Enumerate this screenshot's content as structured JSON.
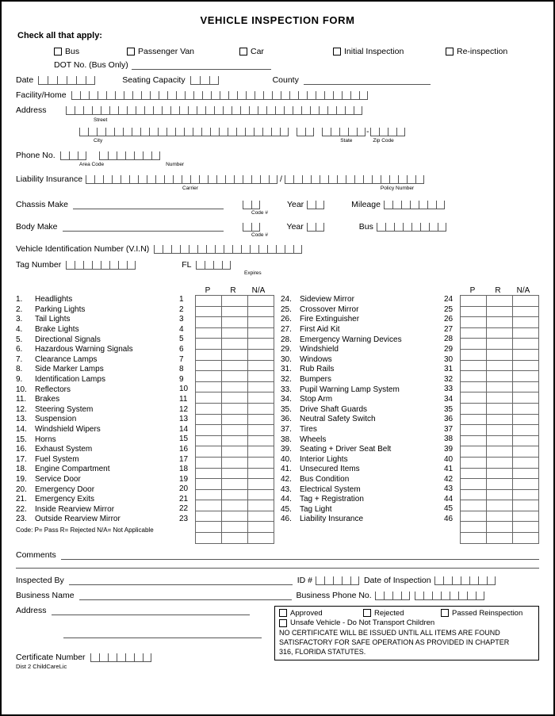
{
  "title": "VEHICLE INSPECTION FORM",
  "check_all_label": "Check all that apply:",
  "vehicle_types": [
    {
      "label": "Bus"
    },
    {
      "label": "Passenger Van"
    },
    {
      "label": "Car"
    },
    {
      "label": "Initial Inspection"
    },
    {
      "label": "Re-inspection"
    }
  ],
  "dot": {
    "label": "DOT No. (Bus Only)"
  },
  "date": {
    "label": "Date",
    "cells": 6
  },
  "seating": {
    "label": "Seating Capacity",
    "cells": 3
  },
  "county": {
    "label": "County"
  },
  "facility": {
    "label": "Facility/Home",
    "cells": 34
  },
  "address": {
    "label": "Address",
    "street_cells": 34,
    "street_caption": "Street",
    "city_cells": 24,
    "city_caption": "City",
    "state_cells": 2,
    "state_caption": "State",
    "zip_cells": 5,
    "zip_caption": "Zip Code",
    "zip4_cells": 4,
    "zip_dash": "-"
  },
  "phone": {
    "label": "Phone No.",
    "area_cells": 3,
    "area_caption": "Area Code",
    "number_cells": 7,
    "number_caption": "Number"
  },
  "liability": {
    "label": "Liability Insurance",
    "carrier_cells": 22,
    "carrier_caption": "Carrier",
    "separator": "/",
    "policy_cells": 16,
    "policy_caption": "Policy Number"
  },
  "chassis": {
    "label": "Chassis Make",
    "code_cells": 2,
    "code_caption": "Code #",
    "year_label": "Year",
    "year_cells": 2,
    "mileage_label": "Mileage",
    "mileage_cells": 7
  },
  "body": {
    "label": "Body Make",
    "code_cells": 2,
    "code_caption": "Code #",
    "year_label": "Year",
    "year_cells": 2,
    "bus_label": "Bus",
    "bus_cells": 8
  },
  "vin": {
    "label": "Vehicle Identification Number (V.I.N)",
    "cells": 17
  },
  "tag": {
    "label": "Tag Number",
    "cells": 8,
    "state_label": "FL",
    "expires_cells": 4,
    "expires_caption": "Expires"
  },
  "checklist": {
    "headers": [
      "P",
      "R",
      "N/A"
    ],
    "code_note": "Code:  P= Pass  R= Rejected  N/A= Not Applicable",
    "left": [
      {
        "num": "1.",
        "grid_num": "1",
        "name": "Headlights"
      },
      {
        "num": "2.",
        "grid_num": "2",
        "name": "Parking Lights"
      },
      {
        "num": "3.",
        "grid_num": "3",
        "name": "Tail Lights"
      },
      {
        "num": "4.",
        "grid_num": "4",
        "name": "Brake Lights"
      },
      {
        "num": "5.",
        "grid_num": "5",
        "name": "Directional Signals"
      },
      {
        "num": "6.",
        "grid_num": "6",
        "name": "Hazardous Warning Signals"
      },
      {
        "num": "7.",
        "grid_num": "7",
        "name": "Clearance Lamps"
      },
      {
        "num": "8.",
        "grid_num": "8",
        "name": "Side Marker Lamps"
      },
      {
        "num": "9.",
        "grid_num": "9",
        "name": "Identification Lamps"
      },
      {
        "num": "10.",
        "grid_num": "10",
        "name": "Reflectors"
      },
      {
        "num": "11.",
        "grid_num": "11",
        "name": "Brakes"
      },
      {
        "num": "12.",
        "grid_num": "12",
        "name": "Steering System"
      },
      {
        "num": "13.",
        "grid_num": "13",
        "name": "Suspension"
      },
      {
        "num": "14.",
        "grid_num": "14",
        "name": "Windshield Wipers"
      },
      {
        "num": "15.",
        "grid_num": "15",
        "name": "Horns"
      },
      {
        "num": "16.",
        "grid_num": "16",
        "name": "Exhaust System"
      },
      {
        "num": "17.",
        "grid_num": "17",
        "name": "Fuel System"
      },
      {
        "num": "18.",
        "grid_num": "18",
        "name": "Engine Compartment"
      },
      {
        "num": "19.",
        "grid_num": "19",
        "name": "Service Door"
      },
      {
        "num": "20.",
        "grid_num": "20",
        "name": "Emergency Door"
      },
      {
        "num": "21.",
        "grid_num": "21",
        "name": "Emergency Exits"
      },
      {
        "num": "22.",
        "grid_num": "22",
        "name": "Inside Rearview Mirror"
      },
      {
        "num": "23.",
        "grid_num": "23",
        "name": "Outside Rearview Mirror"
      }
    ],
    "right": [
      {
        "num": "24.",
        "grid_num": "24",
        "name": "Sideview Mirror"
      },
      {
        "num": "25.",
        "grid_num": "25",
        "name": "Crossover Mirror"
      },
      {
        "num": "26.",
        "grid_num": "26",
        "name": "Fire Extinguisher"
      },
      {
        "num": "27.",
        "grid_num": "27",
        "name": "First Aid Kit"
      },
      {
        "num": "28.",
        "grid_num": "28",
        "name": "Emergency Warning Devices"
      },
      {
        "num": "29.",
        "grid_num": "29",
        "name": "Windshield"
      },
      {
        "num": "30.",
        "grid_num": "30",
        "name": "Windows"
      },
      {
        "num": "31.",
        "grid_num": "31",
        "name": "Rub Rails"
      },
      {
        "num": "32.",
        "grid_num": "32",
        "name": "Bumpers"
      },
      {
        "num": "33.",
        "grid_num": "33",
        "name": "Pupil Warning Lamp System"
      },
      {
        "num": "34.",
        "grid_num": "34",
        "name": "Stop Arm"
      },
      {
        "num": "35.",
        "grid_num": "35",
        "name": "Drive Shaft Guards"
      },
      {
        "num": "36.",
        "grid_num": "36",
        "name": "Neutral Safety Switch"
      },
      {
        "num": "37.",
        "grid_num": "37",
        "name": "Tires"
      },
      {
        "num": "38.",
        "grid_num": "38",
        "name": "Wheels"
      },
      {
        "num": "39.",
        "grid_num": "39",
        "name": "Seating + Driver Seat Belt"
      },
      {
        "num": "40.",
        "grid_num": "40",
        "name": "Interior Lights"
      },
      {
        "num": "41.",
        "grid_num": "41",
        "name": "Unsecured Items"
      },
      {
        "num": "42.",
        "grid_num": "42",
        "name": "Bus Condition"
      },
      {
        "num": "43.",
        "grid_num": "43",
        "name": "Electrical System"
      },
      {
        "num": "44.",
        "grid_num": "44",
        "name": "Tag + Registration"
      },
      {
        "num": "45.",
        "grid_num": "45",
        "name": "Tag Light"
      },
      {
        "num": "46.",
        "grid_num": "46",
        "name": "Liability Insurance"
      }
    ]
  },
  "comments": {
    "label": "Comments"
  },
  "inspected_by": {
    "label": "Inspected By"
  },
  "id_number": {
    "label": "ID #",
    "cells": 5
  },
  "date_of_inspection": {
    "label": "Date of Inspection",
    "cells": 7
  },
  "business_name": {
    "label": "Business Name"
  },
  "business_phone": {
    "label": "Business Phone No.",
    "area_cells": 4,
    "number_cells": 8
  },
  "business_address": {
    "label": "Address"
  },
  "certificate": {
    "label": "Certificate Number",
    "cells": 7
  },
  "dist_note": "Dist 2 ChildCareLic",
  "result_box": {
    "options": [
      {
        "label": "Approved"
      },
      {
        "label": "Rejected"
      },
      {
        "label": "Passed Reinspection"
      }
    ],
    "unsafe_label": "Unsafe Vehicle - Do Not Transport Children",
    "notice_line1": "NO CERTIFICATE WILL BE ISSUED UNTIL ALL ITEMS ARE FOUND",
    "notice_line2": "SATISFACTORY FOR SAFE OPERATION AS PROVIDED IN CHAPTER",
    "notice_line3": "316, FLORIDA STATUTES."
  }
}
